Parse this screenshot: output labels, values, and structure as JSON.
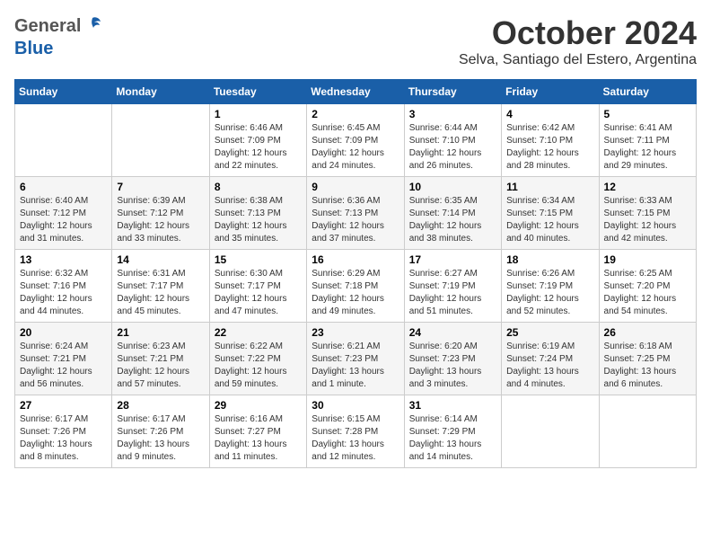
{
  "header": {
    "logo_general": "General",
    "logo_blue": "Blue",
    "month_title": "October 2024",
    "location": "Selva, Santiago del Estero, Argentina"
  },
  "weekdays": [
    "Sunday",
    "Monday",
    "Tuesday",
    "Wednesday",
    "Thursday",
    "Friday",
    "Saturday"
  ],
  "weeks": [
    [
      {
        "day": "",
        "sunrise": "",
        "sunset": "",
        "daylight": ""
      },
      {
        "day": "",
        "sunrise": "",
        "sunset": "",
        "daylight": ""
      },
      {
        "day": "1",
        "sunrise": "Sunrise: 6:46 AM",
        "sunset": "Sunset: 7:09 PM",
        "daylight": "Daylight: 12 hours and 22 minutes."
      },
      {
        "day": "2",
        "sunrise": "Sunrise: 6:45 AM",
        "sunset": "Sunset: 7:09 PM",
        "daylight": "Daylight: 12 hours and 24 minutes."
      },
      {
        "day": "3",
        "sunrise": "Sunrise: 6:44 AM",
        "sunset": "Sunset: 7:10 PM",
        "daylight": "Daylight: 12 hours and 26 minutes."
      },
      {
        "day": "4",
        "sunrise": "Sunrise: 6:42 AM",
        "sunset": "Sunset: 7:10 PM",
        "daylight": "Daylight: 12 hours and 28 minutes."
      },
      {
        "day": "5",
        "sunrise": "Sunrise: 6:41 AM",
        "sunset": "Sunset: 7:11 PM",
        "daylight": "Daylight: 12 hours and 29 minutes."
      }
    ],
    [
      {
        "day": "6",
        "sunrise": "Sunrise: 6:40 AM",
        "sunset": "Sunset: 7:12 PM",
        "daylight": "Daylight: 12 hours and 31 minutes."
      },
      {
        "day": "7",
        "sunrise": "Sunrise: 6:39 AM",
        "sunset": "Sunset: 7:12 PM",
        "daylight": "Daylight: 12 hours and 33 minutes."
      },
      {
        "day": "8",
        "sunrise": "Sunrise: 6:38 AM",
        "sunset": "Sunset: 7:13 PM",
        "daylight": "Daylight: 12 hours and 35 minutes."
      },
      {
        "day": "9",
        "sunrise": "Sunrise: 6:36 AM",
        "sunset": "Sunset: 7:13 PM",
        "daylight": "Daylight: 12 hours and 37 minutes."
      },
      {
        "day": "10",
        "sunrise": "Sunrise: 6:35 AM",
        "sunset": "Sunset: 7:14 PM",
        "daylight": "Daylight: 12 hours and 38 minutes."
      },
      {
        "day": "11",
        "sunrise": "Sunrise: 6:34 AM",
        "sunset": "Sunset: 7:15 PM",
        "daylight": "Daylight: 12 hours and 40 minutes."
      },
      {
        "day": "12",
        "sunrise": "Sunrise: 6:33 AM",
        "sunset": "Sunset: 7:15 PM",
        "daylight": "Daylight: 12 hours and 42 minutes."
      }
    ],
    [
      {
        "day": "13",
        "sunrise": "Sunrise: 6:32 AM",
        "sunset": "Sunset: 7:16 PM",
        "daylight": "Daylight: 12 hours and 44 minutes."
      },
      {
        "day": "14",
        "sunrise": "Sunrise: 6:31 AM",
        "sunset": "Sunset: 7:17 PM",
        "daylight": "Daylight: 12 hours and 45 minutes."
      },
      {
        "day": "15",
        "sunrise": "Sunrise: 6:30 AM",
        "sunset": "Sunset: 7:17 PM",
        "daylight": "Daylight: 12 hours and 47 minutes."
      },
      {
        "day": "16",
        "sunrise": "Sunrise: 6:29 AM",
        "sunset": "Sunset: 7:18 PM",
        "daylight": "Daylight: 12 hours and 49 minutes."
      },
      {
        "day": "17",
        "sunrise": "Sunrise: 6:27 AM",
        "sunset": "Sunset: 7:19 PM",
        "daylight": "Daylight: 12 hours and 51 minutes."
      },
      {
        "day": "18",
        "sunrise": "Sunrise: 6:26 AM",
        "sunset": "Sunset: 7:19 PM",
        "daylight": "Daylight: 12 hours and 52 minutes."
      },
      {
        "day": "19",
        "sunrise": "Sunrise: 6:25 AM",
        "sunset": "Sunset: 7:20 PM",
        "daylight": "Daylight: 12 hours and 54 minutes."
      }
    ],
    [
      {
        "day": "20",
        "sunrise": "Sunrise: 6:24 AM",
        "sunset": "Sunset: 7:21 PM",
        "daylight": "Daylight: 12 hours and 56 minutes."
      },
      {
        "day": "21",
        "sunrise": "Sunrise: 6:23 AM",
        "sunset": "Sunset: 7:21 PM",
        "daylight": "Daylight: 12 hours and 57 minutes."
      },
      {
        "day": "22",
        "sunrise": "Sunrise: 6:22 AM",
        "sunset": "Sunset: 7:22 PM",
        "daylight": "Daylight: 12 hours and 59 minutes."
      },
      {
        "day": "23",
        "sunrise": "Sunrise: 6:21 AM",
        "sunset": "Sunset: 7:23 PM",
        "daylight": "Daylight: 13 hours and 1 minute."
      },
      {
        "day": "24",
        "sunrise": "Sunrise: 6:20 AM",
        "sunset": "Sunset: 7:23 PM",
        "daylight": "Daylight: 13 hours and 3 minutes."
      },
      {
        "day": "25",
        "sunrise": "Sunrise: 6:19 AM",
        "sunset": "Sunset: 7:24 PM",
        "daylight": "Daylight: 13 hours and 4 minutes."
      },
      {
        "day": "26",
        "sunrise": "Sunrise: 6:18 AM",
        "sunset": "Sunset: 7:25 PM",
        "daylight": "Daylight: 13 hours and 6 minutes."
      }
    ],
    [
      {
        "day": "27",
        "sunrise": "Sunrise: 6:17 AM",
        "sunset": "Sunset: 7:26 PM",
        "daylight": "Daylight: 13 hours and 8 minutes."
      },
      {
        "day": "28",
        "sunrise": "Sunrise: 6:17 AM",
        "sunset": "Sunset: 7:26 PM",
        "daylight": "Daylight: 13 hours and 9 minutes."
      },
      {
        "day": "29",
        "sunrise": "Sunrise: 6:16 AM",
        "sunset": "Sunset: 7:27 PM",
        "daylight": "Daylight: 13 hours and 11 minutes."
      },
      {
        "day": "30",
        "sunrise": "Sunrise: 6:15 AM",
        "sunset": "Sunset: 7:28 PM",
        "daylight": "Daylight: 13 hours and 12 minutes."
      },
      {
        "day": "31",
        "sunrise": "Sunrise: 6:14 AM",
        "sunset": "Sunset: 7:29 PM",
        "daylight": "Daylight: 13 hours and 14 minutes."
      },
      {
        "day": "",
        "sunrise": "",
        "sunset": "",
        "daylight": ""
      },
      {
        "day": "",
        "sunrise": "",
        "sunset": "",
        "daylight": ""
      }
    ]
  ]
}
